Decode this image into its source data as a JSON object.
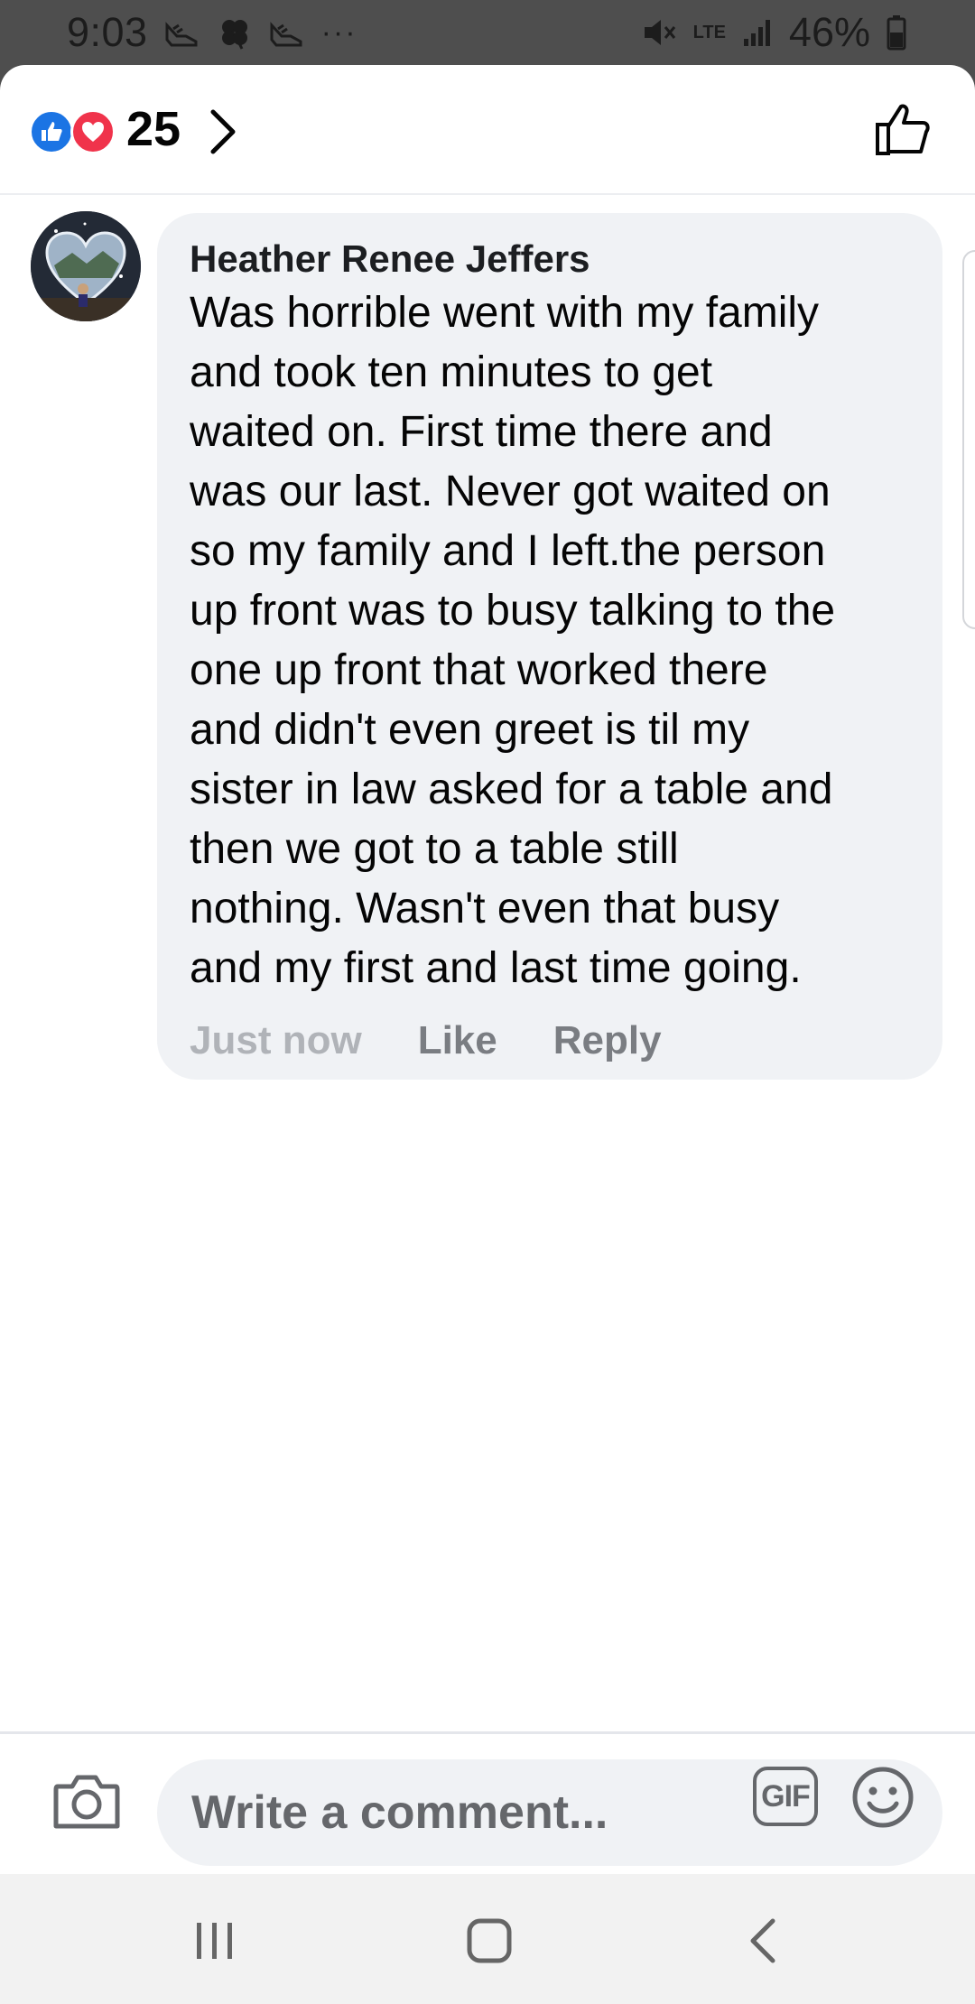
{
  "status_bar": {
    "time": "9:03",
    "more_indicator": "···",
    "network_label": "LTE",
    "battery": "46%",
    "icons": [
      "sneaker-icon",
      "clover-icon",
      "sneaker-icon",
      "mute-icon",
      "signal-icon",
      "battery-icon"
    ]
  },
  "reactions": {
    "count": "25",
    "types": [
      "like",
      "love"
    ],
    "colors": {
      "like": "#1b74e4",
      "love": "#f0334b"
    }
  },
  "comment": {
    "author": "Heather Renee Jeffers",
    "text": "Was horrible went with my family\nand took ten minutes to get\nwaited on. First time there and\nwas our last.  Never got waited on\nso my family and I left.the person\nup front was to busy talking to the\none up front that worked there\nand didn't even greet is til my\nsister in law asked for a table and\nthen we got to a table still\nnothing. Wasn't even that busy\nand my first and last time going.",
    "timestamp": "Just now",
    "like_label": "Like",
    "reply_label": "Reply"
  },
  "composer": {
    "placeholder": "Write a comment...",
    "gif_label": "GIF"
  },
  "theme": {
    "bubble_bg": "#f0f2f5",
    "muted_text": "#65676b",
    "status_bar_bg": "#4e4e4e"
  }
}
